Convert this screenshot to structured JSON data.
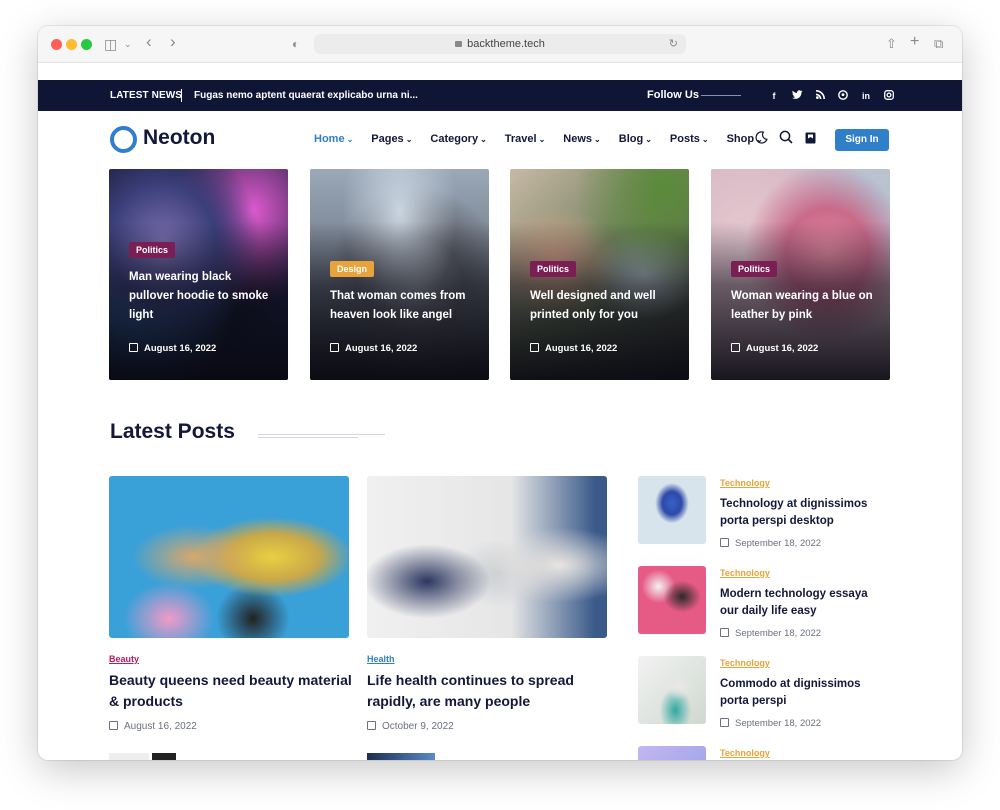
{
  "browser": {
    "url": "backtheme.tech",
    "icons": [
      "sidebar-icon",
      "chevron-down-icon",
      "back-icon",
      "forward-icon",
      "shield-icon",
      "lock-icon",
      "reload-icon",
      "share-icon",
      "new-tab-icon",
      "tabs-icon"
    ]
  },
  "topbar": {
    "latest_label": "LATEST NEWS",
    "ticker": "Fugas nemo aptent quaerat explicabo urna ni...",
    "follow_label": "Follow Us",
    "socials": [
      "f",
      "t",
      "r",
      "p",
      "in",
      "ig"
    ]
  },
  "header": {
    "logo": "Neoton",
    "nav": [
      {
        "label": "Home",
        "active": true
      },
      {
        "label": "Pages",
        "active": false
      },
      {
        "label": "Category",
        "active": false
      },
      {
        "label": "Travel",
        "active": false
      },
      {
        "label": "News",
        "active": false
      },
      {
        "label": "Blog",
        "active": false
      },
      {
        "label": "Posts",
        "active": false
      },
      {
        "label": "Shop",
        "active": false
      }
    ],
    "signin": "Sign In"
  },
  "featured": [
    {
      "category": "Politics",
      "cat_color": "#7b1e53",
      "title": "Man wearing black pullover hoodie to smoke light",
      "date": "August 16, 2022"
    },
    {
      "category": "Design",
      "cat_color": "#e8a33a",
      "title": "That woman comes from heaven look like angel",
      "date": "August 16, 2022"
    },
    {
      "category": "Politics",
      "cat_color": "#7b1e53",
      "title": "Well designed and well printed only for you",
      "date": "August 16, 2022"
    },
    {
      "category": "Politics",
      "cat_color": "#7b1e53",
      "title": "Woman wearing a blue on leather by pink",
      "date": "August 16, 2022"
    }
  ],
  "latest": {
    "title": "Latest Posts",
    "main_posts": [
      {
        "category": "Beauty",
        "cat_color": "#c2185b",
        "title": "Beauty queens need beauty material & products",
        "date": "August 16, 2022"
      },
      {
        "category": "Health",
        "cat_color": "#2f80c8",
        "title": "Life health continues to spread rapidly, are many people",
        "date": "October 9, 2022"
      }
    ],
    "side_posts": [
      {
        "category": "Technology",
        "title": "Technology at dignissimos porta perspi desktop",
        "date": "September 18, 2022"
      },
      {
        "category": "Technology",
        "title": "Modern technology essaya our daily life easy",
        "date": "September 18, 2022"
      },
      {
        "category": "Technology",
        "title": "Commodo at dignissimos porta perspi",
        "date": "September 18, 2022"
      },
      {
        "category": "Technology",
        "title": "",
        "date": ""
      }
    ]
  }
}
